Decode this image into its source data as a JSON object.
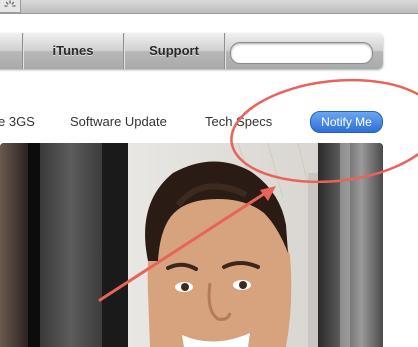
{
  "nav": {
    "itunes_label": "iTunes",
    "support_label": "Support",
    "search_placeholder": ""
  },
  "subnav": {
    "item_3gs": "e 3GS",
    "software_update": "Software Update",
    "tech_specs": "Tech Specs",
    "notify_me": "Notify Me"
  },
  "annotations": {
    "circle_color": "#e8645a",
    "arrow_color": "#e8645a"
  },
  "colors": {
    "notify_button": "#3b7fe0"
  }
}
